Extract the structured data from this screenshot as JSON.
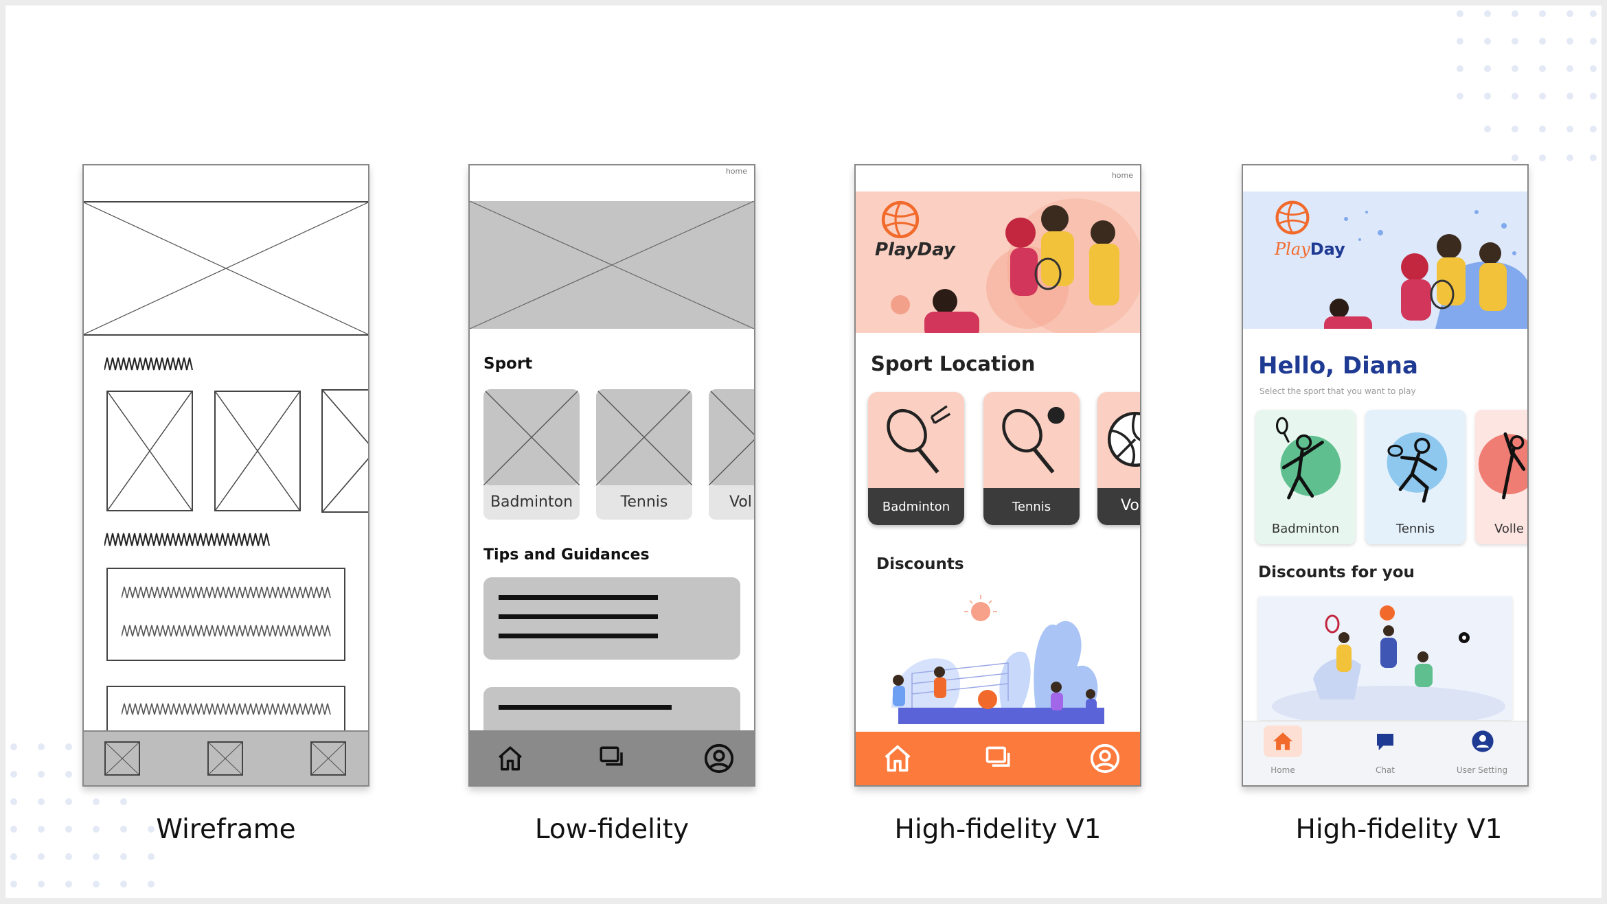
{
  "stages": [
    {
      "caption": "Wireframe"
    },
    {
      "caption": "Low-fidelity",
      "status_label": "home",
      "section_sport": "Sport",
      "cards": [
        "Badminton",
        "Tennis",
        "Vol"
      ],
      "section_tips": "Tips and Guidances"
    },
    {
      "caption": "High-fidelity V1",
      "status_label": "home",
      "brand": "PlayDay",
      "section_sport": "Sport Location",
      "cards": [
        "Badminton",
        "Tennis",
        "Vo"
      ],
      "section_discounts": "Discounts",
      "accent": "#fb7a3c"
    },
    {
      "caption": "High-fidelity V1",
      "brand_part1": "Play",
      "brand_part2": "Day",
      "greeting": "Hello, Diana",
      "subtitle": "Select the sport that you want to play",
      "cards": [
        "Badminton",
        "Tennis",
        "Volle"
      ],
      "section_discounts": "Discounts for you",
      "nav": [
        "Home",
        "Chat",
        "User Setting"
      ],
      "accent": "#1f3a93"
    }
  ]
}
